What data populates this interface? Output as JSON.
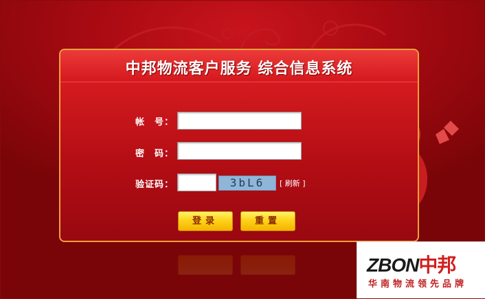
{
  "panel": {
    "title": "中邦物流客户服务 综合信息系统"
  },
  "form": {
    "account_label": "帐　号：",
    "password_label": "密　码：",
    "captcha_label": "验证码：",
    "account_value": "",
    "password_value": "",
    "captcha_value": "",
    "captcha_image_text": "3bL6",
    "refresh_label": "[ 刷新 ]"
  },
  "buttons": {
    "login": "登录",
    "reset": "重置"
  },
  "brand": {
    "logo": "ZBON",
    "logo_cn": "中邦",
    "slogan": "华南物流领先品牌"
  },
  "colors": {
    "background": "#a80a12",
    "panel": "#d31b1f",
    "border": "#f0a23c",
    "button": "#ffd21a"
  }
}
